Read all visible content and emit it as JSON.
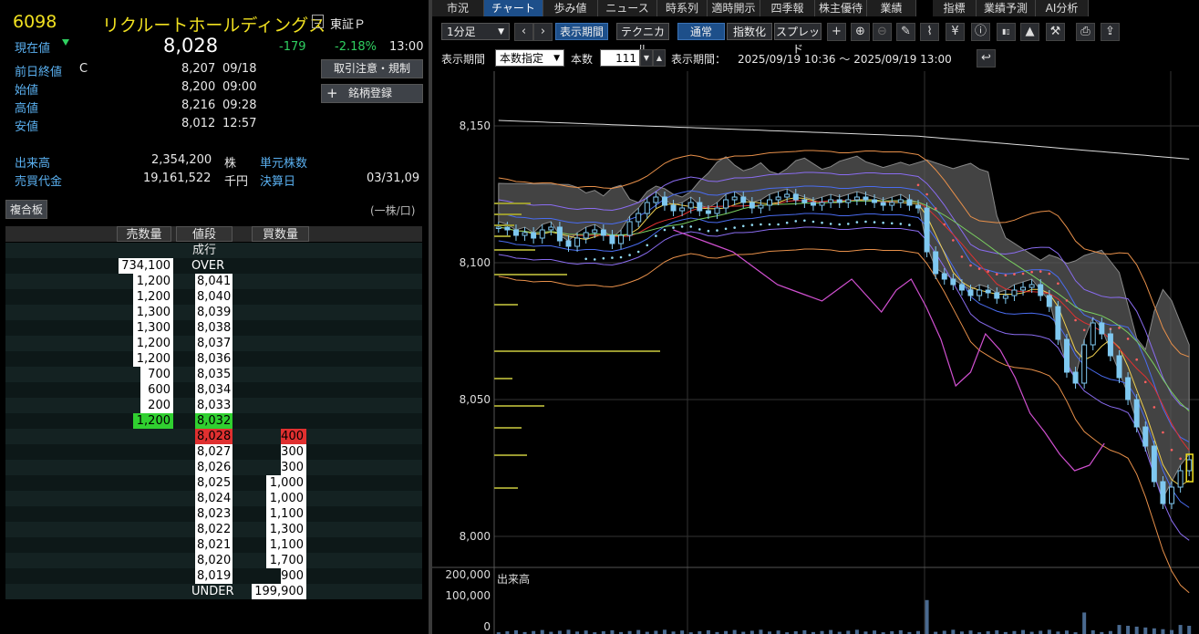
{
  "stock": {
    "code": "6098",
    "name": "リクルートホールディングス",
    "market": "東証Ｐ",
    "current_label": "現在値",
    "current_price": "8,028",
    "change": "-179",
    "change_pct": "-2.18%",
    "time": "13:00",
    "prev_close_label": "前日終値",
    "prev_close_flag": "C",
    "prev_close": "8,207",
    "prev_close_date": "09/18",
    "open_label": "始値",
    "open": "8,200",
    "open_time": "09:00",
    "high_label": "高値",
    "high": "8,216",
    "high_time": "09:28",
    "low_label": "安値",
    "low": "8,012",
    "low_time": "12:57",
    "volume_label": "出来高",
    "volume": "2,354,200",
    "volume_unit": "株",
    "turnover_label": "売買代金",
    "turnover": "19,161,522",
    "turnover_unit": "千円",
    "unit_shares_label": "単元株数",
    "settle_label": "決算日",
    "settle_date": "03/31,09",
    "btn_caution": "取引注意・規制",
    "btn_register": "銘柄登録"
  },
  "board": {
    "title": "複合板",
    "unit_note": "(一株/口)",
    "col_sell": "売数量",
    "col_price": "値段",
    "col_buy": "買数量",
    "market_order": "成行",
    "rows": [
      {
        "sell": "734,100",
        "price": "OVER",
        "buy": ""
      },
      {
        "sell": "1,200",
        "price": "8,041",
        "buy": ""
      },
      {
        "sell": "1,200",
        "price": "8,040",
        "buy": ""
      },
      {
        "sell": "1,300",
        "price": "8,039",
        "buy": ""
      },
      {
        "sell": "1,300",
        "price": "8,038",
        "buy": ""
      },
      {
        "sell": "1,200",
        "price": "8,037",
        "buy": ""
      },
      {
        "sell": "1,200",
        "price": "8,036",
        "buy": ""
      },
      {
        "sell": "700",
        "price": "8,035",
        "buy": ""
      },
      {
        "sell": "600",
        "price": "8,034",
        "buy": ""
      },
      {
        "sell": "200",
        "price": "8,033",
        "buy": ""
      },
      {
        "sell": "1,200",
        "price": "8,032",
        "buy": ""
      },
      {
        "sell": "",
        "price": "8,028",
        "buy": "400"
      },
      {
        "sell": "",
        "price": "8,027",
        "buy": "300"
      },
      {
        "sell": "",
        "price": "8,026",
        "buy": "300"
      },
      {
        "sell": "",
        "price": "8,025",
        "buy": "1,000"
      },
      {
        "sell": "",
        "price": "8,024",
        "buy": "1,000"
      },
      {
        "sell": "",
        "price": "8,023",
        "buy": "1,100"
      },
      {
        "sell": "",
        "price": "8,022",
        "buy": "1,300"
      },
      {
        "sell": "",
        "price": "8,021",
        "buy": "1,100"
      },
      {
        "sell": "",
        "price": "8,020",
        "buy": "1,700"
      },
      {
        "sell": "",
        "price": "8,019",
        "buy": "900"
      },
      {
        "sell": "",
        "price": "UNDER",
        "buy": "199,900"
      }
    ]
  },
  "tabs": [
    "市況",
    "チャート",
    "歩み値",
    "ニュース",
    "時系列",
    "適時開示",
    "四季報",
    "株主優待",
    "業績",
    "指標",
    "業績予測",
    "AI分析"
  ],
  "toolbar": {
    "interval": "1分足",
    "period_btn": "表示期間",
    "technical_btn": "テクニカル",
    "normal_btn": "通常",
    "index_btn": "指数化",
    "spread_btn": "スプレッド",
    "period_label": "表示期間",
    "count_mode": "本数指定",
    "count_label": "本数",
    "count_value": "111",
    "range_label": "表示期間：",
    "range_value": "2025/09/19 10:36 ～ 2025/09/19 13:00"
  },
  "axis": {
    "price_ticks": [
      "8,150",
      "8,100",
      "8,050",
      "8,000"
    ],
    "volume_ticks": [
      "200,000",
      "100,000",
      "0"
    ],
    "volume_label": "出来高"
  },
  "colors": {
    "accent_blue": "#1d4f8a",
    "up_green": "#2fd060",
    "down_red": "#e03030",
    "code_yellow": "#f0e020",
    "label_blue": "#5ab0f0"
  },
  "chart_data": {
    "type": "candlestick",
    "x_range": [
      "2025/09/19 10:36",
      "2025/09/19 13:00"
    ],
    "ylim": [
      7990,
      8170
    ],
    "bars": 111,
    "price_path": [
      8113,
      8112,
      8110,
      8111,
      8109,
      8112,
      8113,
      8108,
      8106,
      8109,
      8111,
      8112,
      8110,
      8107,
      8110,
      8115,
      8118,
      8122,
      8124,
      8121,
      8119,
      8120,
      8122,
      8119,
      8118,
      8120,
      8123,
      8124,
      8122,
      8120,
      8121,
      8123,
      8124,
      8125,
      8123,
      8122,
      8121,
      8122,
      8123,
      8122,
      8123,
      8124,
      8123,
      8122,
      8121,
      8122,
      8123,
      8121,
      8120,
      8104,
      8096,
      8094,
      8092,
      8090,
      8088,
      8090,
      8089,
      8087,
      8088,
      8090,
      8091,
      8092,
      8088,
      8084,
      8072,
      8060,
      8056,
      8070,
      8078,
      8074,
      8066,
      8058,
      8050,
      8040,
      8033,
      8020,
      8012,
      8018,
      8024,
      8028
    ],
    "volume_ticks_max": 200000
  }
}
